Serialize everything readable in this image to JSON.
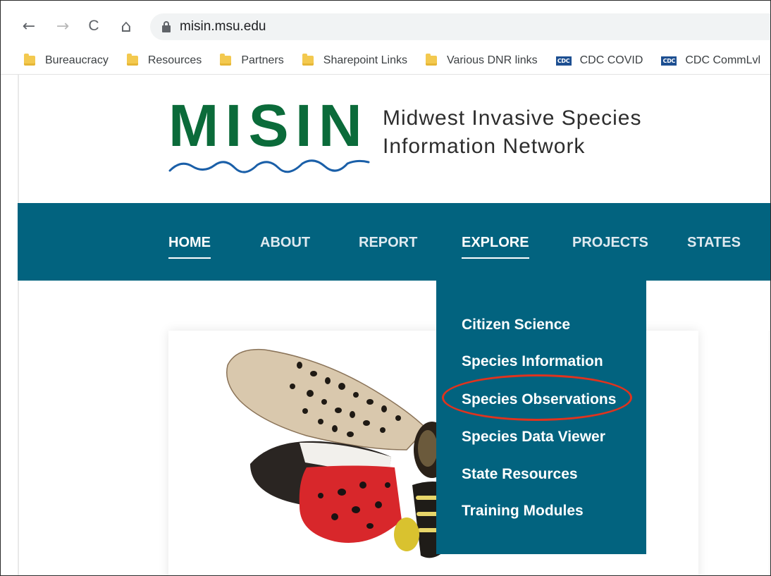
{
  "browser": {
    "url": "misin.msu.edu",
    "back_icon": "←",
    "forward_icon": "→",
    "reload_icon": "C",
    "home_icon": "⌂"
  },
  "bookmarks": [
    {
      "label": "Bureaucracy",
      "icon": "folder-icon"
    },
    {
      "label": "Resources",
      "icon": "folder-icon"
    },
    {
      "label": "Partners",
      "icon": "folder-icon"
    },
    {
      "label": "Sharepoint Links",
      "icon": "folder-icon"
    },
    {
      "label": "Various DNR links",
      "icon": "folder-icon"
    },
    {
      "label": "CDC COVID",
      "icon": "cdc-icon",
      "icon_text": "CDC"
    },
    {
      "label": "CDC CommLvl",
      "icon": "cdc-icon",
      "icon_text": "CDC"
    }
  ],
  "logo": {
    "word": "MISIN",
    "line1": "Midwest Invasive Species",
    "line2": "Information Network",
    "color": "#0b6b3a",
    "wave_color": "#1a5fa8"
  },
  "nav": {
    "items": [
      {
        "label": "HOME",
        "active": true
      },
      {
        "label": "ABOUT",
        "active": false
      },
      {
        "label": "REPORT",
        "active": false
      },
      {
        "label": "EXPLORE",
        "active": true
      },
      {
        "label": "PROJECTS",
        "active": false
      },
      {
        "label": "STATES",
        "active": false
      }
    ],
    "bg_color": "#02637f"
  },
  "explore_menu": {
    "items": [
      "Citizen Science",
      "Species Information",
      "Species Observations",
      "Species Data Viewer",
      "State Resources",
      "Training Modules"
    ],
    "highlighted": "Species Observations",
    "highlight_color": "#e0331e"
  }
}
